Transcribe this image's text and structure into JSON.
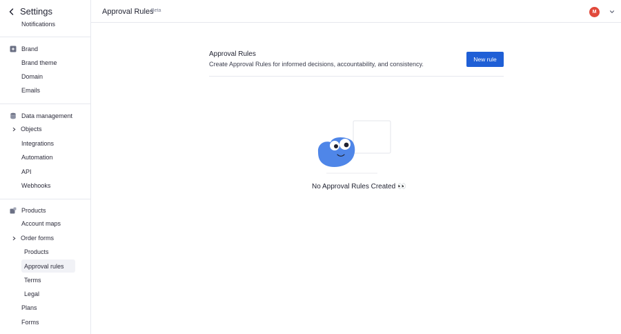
{
  "sidebar": {
    "title": "Settings",
    "notifications": "Notifications",
    "brand": {
      "section": "Brand",
      "items": [
        "Brand theme",
        "Domain",
        "Emails"
      ]
    },
    "data_management": {
      "section": "Data management",
      "objects": "Objects",
      "items": [
        "Integrations",
        "Automation",
        "API",
        "Webhooks"
      ]
    },
    "products": {
      "section": "Products",
      "account_maps": "Account maps",
      "order_forms": "Order forms",
      "sub_items": [
        "Products",
        "Approval rules",
        "Terms",
        "Legal"
      ],
      "items_after": [
        "Plans",
        "Forms"
      ]
    }
  },
  "topbar": {
    "title": "Approval Rules",
    "badge": "Beta",
    "avatar_initials": "M"
  },
  "content": {
    "title": "Approval Rules",
    "description": "Create Approval Rules for informed decisions, accountability, and consistency.",
    "new_rule_label": "New rule",
    "empty_state": "No Approval Rules Created 👀"
  },
  "colors": {
    "accent": "#1f5fd6",
    "avatar": "#e1493b",
    "mascot": "#4f86e8"
  }
}
